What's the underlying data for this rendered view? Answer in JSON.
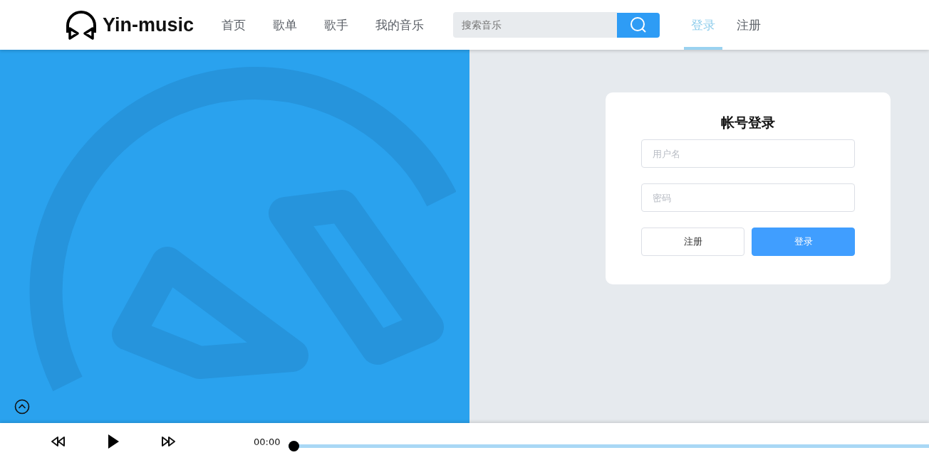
{
  "header": {
    "brand": "Yin-music",
    "nav": [
      {
        "label": "首页",
        "selected": false
      },
      {
        "label": "歌单",
        "selected": false
      },
      {
        "label": "歌手",
        "selected": false
      },
      {
        "label": "我的音乐",
        "selected": false
      }
    ],
    "search": {
      "placeholder": "搜索音乐"
    },
    "account": [
      {
        "label": "登录",
        "selected": true
      },
      {
        "label": "注册",
        "selected": false
      }
    ]
  },
  "login": {
    "title": "帐号登录",
    "fields": [
      {
        "placeholder": "用户名"
      },
      {
        "placeholder": "密码"
      }
    ],
    "buttons": [
      {
        "label": "注册",
        "kind": "plain"
      },
      {
        "label": "登录",
        "kind": "primary"
      }
    ]
  },
  "player": {
    "time": "00:00",
    "level": 0
  }
}
